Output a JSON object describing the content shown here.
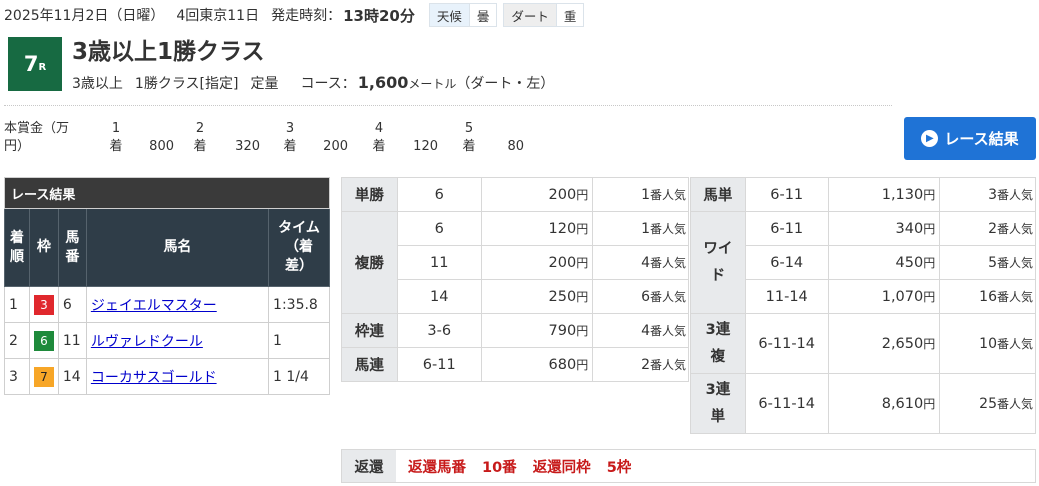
{
  "header": {
    "date": "2025年11月2日（日曜）",
    "meeting": "4回東京11日",
    "post_time_label": "発走時刻：",
    "post_time": "13時20分",
    "weather_label": "天候",
    "weather": "曇",
    "track_label": "ダート",
    "track_condition": "重"
  },
  "race": {
    "number": "7",
    "number_suffix": "R",
    "title": "3歳以上1勝クラス",
    "sub_age": "3歳以上",
    "sub_class": "1勝クラス[指定]",
    "sub_weight": "定量",
    "course_label": "コース：",
    "distance": "1,600",
    "distance_unit": "メートル",
    "surface": "（ダート・左）"
  },
  "prize": {
    "label_line1": "本賞金（万",
    "label_line2": "円）",
    "places": [
      "1",
      "2",
      "3",
      "4",
      "5"
    ],
    "suffix": "着",
    "amounts": [
      "800",
      "320",
      "200",
      "120",
      "80"
    ]
  },
  "result_button": {
    "label": "レース結果",
    "icon": "chevron-right-icon"
  },
  "results": {
    "caption": "レース結果",
    "headers": {
      "place": [
        "着",
        "順"
      ],
      "waku": "枠",
      "umaban": [
        "馬",
        "番"
      ],
      "name": "馬名",
      "time": [
        "タイム",
        "（着",
        "差）"
      ]
    },
    "rows": [
      {
        "place": "1",
        "waku": "3",
        "umaban": "6",
        "name": "ジェイエルマスター",
        "time": "1:35.8"
      },
      {
        "place": "2",
        "waku": "6",
        "umaban": "11",
        "name": "ルヴァレドクール",
        "time": "1"
      },
      {
        "place": "3",
        "waku": "7",
        "umaban": "14",
        "name": "コーカサスゴールド",
        "time": "1 1/4"
      }
    ]
  },
  "payouts_left": {
    "yen": "円",
    "pop_suffix": "番人気",
    "tansho": {
      "label": "単勝",
      "rows": [
        {
          "horse": "6",
          "pay": "200",
          "pop": "1"
        }
      ]
    },
    "fukusho": {
      "label": "複勝",
      "rows": [
        {
          "horse": "6",
          "pay": "120",
          "pop": "1"
        },
        {
          "horse": "11",
          "pay": "200",
          "pop": "4"
        },
        {
          "horse": "14",
          "pay": "250",
          "pop": "6"
        }
      ]
    },
    "wakuren": {
      "label": "枠連",
      "rows": [
        {
          "horse": "3-6",
          "pay": "790",
          "pop": "4"
        }
      ]
    },
    "umaren": {
      "label": "馬連",
      "rows": [
        {
          "horse": "6-11",
          "pay": "680",
          "pop": "2"
        }
      ]
    }
  },
  "payouts_right": {
    "umatan": {
      "label": "馬単",
      "rows": [
        {
          "horse": "6-11",
          "pay": "1,130",
          "pop": "3"
        }
      ]
    },
    "wide": {
      "label_line1": "ワイ",
      "label_line2": "ド",
      "rows": [
        {
          "horse": "6-11",
          "pay": "340",
          "pop": "2"
        },
        {
          "horse": "6-14",
          "pay": "450",
          "pop": "5"
        },
        {
          "horse": "11-14",
          "pay": "1,070",
          "pop": "16"
        }
      ]
    },
    "sanrenpuku": {
      "label_line1": "3連",
      "label_line2": "複",
      "rows": [
        {
          "horse": "6-11-14",
          "pay": "2,650",
          "pop": "10"
        }
      ]
    },
    "sanrentan": {
      "label_line1": "3連",
      "label_line2": "単",
      "rows": [
        {
          "horse": "6-11-14",
          "pay": "8,610",
          "pop": "25"
        }
      ]
    }
  },
  "refund": {
    "label": "返還",
    "horse_label": "返還馬番",
    "horse_value": "10番",
    "frame_label": "返還同枠",
    "frame_value": "5枠"
  },
  "colors": {
    "race_number_bg": "#176a42",
    "button_bg": "#1f73d6",
    "refund_text": "#c71a1a",
    "waku3": "#e0282d",
    "waku6": "#1e8a3b",
    "waku7": "#f7a627"
  }
}
